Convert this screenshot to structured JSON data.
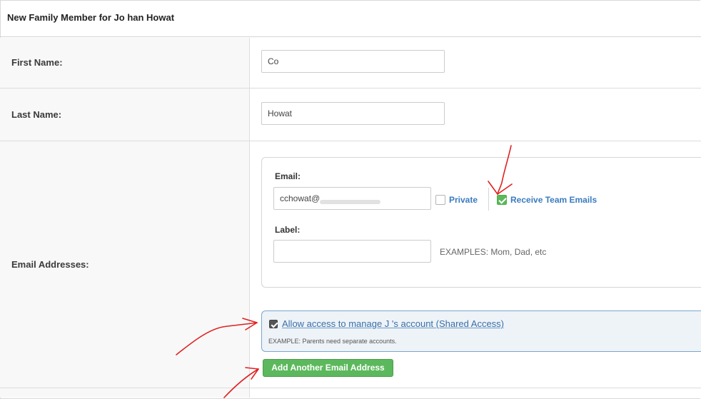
{
  "header": {
    "title": "New Family Member for Jo      han Howat"
  },
  "rows": {
    "first_name": {
      "label": "First Name:",
      "value": "Co"
    },
    "last_name": {
      "label": "Last Name:",
      "value": "Howat"
    },
    "emails": {
      "label": "Email Addresses:"
    }
  },
  "email_entry": {
    "email_label": "Email:",
    "email_value": "cchowat@",
    "private_label": "Private",
    "receive_label": "Receive Team Emails",
    "label_label": "Label:",
    "label_value": "",
    "examples_text": "EXAMPLES: Mom, Dad, etc"
  },
  "shared_access": {
    "label": "Allow access to manage J         's account (Shared Access)",
    "example": "EXAMPLE: Parents need separate accounts."
  },
  "add_email_button": "Add Another Email Address",
  "colors": {
    "accent_green": "#5cb85c",
    "link_blue": "#3a7bbf",
    "annotation_red": "#e02020"
  }
}
